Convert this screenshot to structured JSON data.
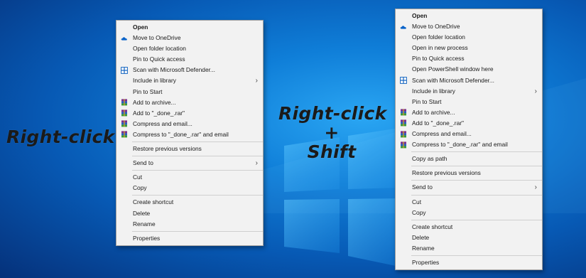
{
  "captions": {
    "left": "Right-click",
    "right_line1": "Right-click",
    "right_line2": "+",
    "right_line3": "Shift"
  },
  "menus": {
    "normal": [
      {
        "type": "item",
        "label": "Open",
        "bold": true
      },
      {
        "type": "item",
        "label": "Move to OneDrive",
        "icon": "onedrive-cloud-icon"
      },
      {
        "type": "item",
        "label": "Open folder location"
      },
      {
        "type": "item",
        "label": "Pin to Quick access"
      },
      {
        "type": "item",
        "label": "Scan with Microsoft Defender...",
        "icon": "defender-shield-icon"
      },
      {
        "type": "item",
        "label": "Include in library",
        "submenu": true
      },
      {
        "type": "item",
        "label": "Pin to Start"
      },
      {
        "type": "item",
        "label": "Add to archive...",
        "icon": "winrar-archive-icon"
      },
      {
        "type": "item",
        "label": "Add to \"_done_.rar\"",
        "icon": "winrar-archive-icon"
      },
      {
        "type": "item",
        "label": "Compress and email...",
        "icon": "winrar-archive-icon"
      },
      {
        "type": "item",
        "label": "Compress to \"_done_.rar\" and email",
        "icon": "winrar-archive-icon"
      },
      {
        "type": "separator"
      },
      {
        "type": "item",
        "label": "Restore previous versions"
      },
      {
        "type": "separator"
      },
      {
        "type": "item",
        "label": "Send to",
        "submenu": true
      },
      {
        "type": "separator"
      },
      {
        "type": "item",
        "label": "Cut"
      },
      {
        "type": "item",
        "label": "Copy"
      },
      {
        "type": "separator"
      },
      {
        "type": "item",
        "label": "Create shortcut"
      },
      {
        "type": "item",
        "label": "Delete"
      },
      {
        "type": "item",
        "label": "Rename"
      },
      {
        "type": "separator"
      },
      {
        "type": "item",
        "label": "Properties"
      }
    ],
    "extended": [
      {
        "type": "item",
        "label": "Open",
        "bold": true
      },
      {
        "type": "item",
        "label": "Move to OneDrive",
        "icon": "onedrive-cloud-icon"
      },
      {
        "type": "item",
        "label": "Open folder location"
      },
      {
        "type": "item",
        "label": "Open in new process"
      },
      {
        "type": "item",
        "label": "Pin to Quick access"
      },
      {
        "type": "item",
        "label": "Open PowerShell window here"
      },
      {
        "type": "item",
        "label": "Scan with Microsoft Defender...",
        "icon": "defender-shield-icon"
      },
      {
        "type": "item",
        "label": "Include in library",
        "submenu": true
      },
      {
        "type": "item",
        "label": "Pin to Start"
      },
      {
        "type": "item",
        "label": "Add to archive...",
        "icon": "winrar-archive-icon"
      },
      {
        "type": "item",
        "label": "Add to \"_done_.rar\"",
        "icon": "winrar-archive-icon"
      },
      {
        "type": "item",
        "label": "Compress and email...",
        "icon": "winrar-archive-icon"
      },
      {
        "type": "item",
        "label": "Compress to \"_done_.rar\" and email",
        "icon": "winrar-archive-icon"
      },
      {
        "type": "separator"
      },
      {
        "type": "item",
        "label": "Copy as path"
      },
      {
        "type": "separator"
      },
      {
        "type": "item",
        "label": "Restore previous versions"
      },
      {
        "type": "separator"
      },
      {
        "type": "item",
        "label": "Send to",
        "submenu": true
      },
      {
        "type": "separator"
      },
      {
        "type": "item",
        "label": "Cut"
      },
      {
        "type": "item",
        "label": "Copy"
      },
      {
        "type": "separator"
      },
      {
        "type": "item",
        "label": "Create shortcut"
      },
      {
        "type": "item",
        "label": "Delete"
      },
      {
        "type": "item",
        "label": "Rename"
      },
      {
        "type": "separator"
      },
      {
        "type": "item",
        "label": "Properties"
      }
    ]
  },
  "colors": {
    "desktop": "#0f7ed8",
    "menu_background": "#f2f2f2",
    "caption_text": "#1a1a1a"
  }
}
